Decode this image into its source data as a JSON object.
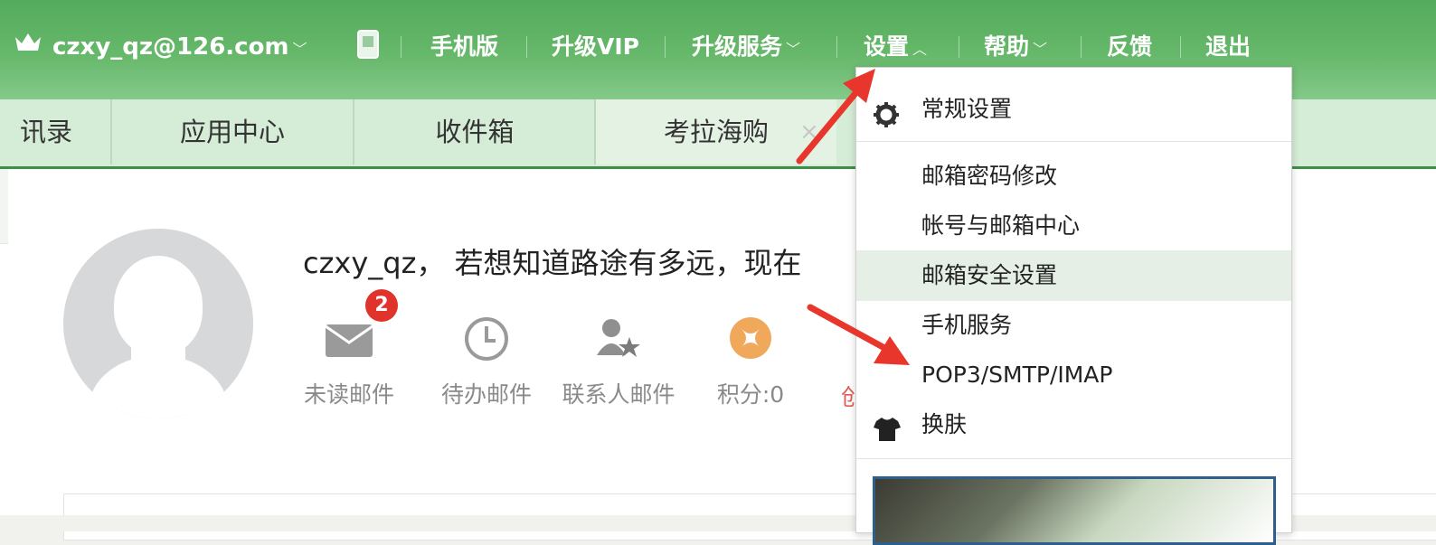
{
  "header": {
    "account": "czxy_qz@126.com",
    "nav": [
      {
        "label": "手机版"
      },
      {
        "label": "升级VIP"
      },
      {
        "label": "升级服务"
      },
      {
        "label": "设置"
      },
      {
        "label": "帮助"
      },
      {
        "label": "反馈"
      },
      {
        "label": "退出"
      }
    ]
  },
  "tabs": [
    {
      "label": "讯录"
    },
    {
      "label": "应用中心"
    },
    {
      "label": "收件箱"
    },
    {
      "label": "考拉海购"
    }
  ],
  "tab_close": "×",
  "welcome": {
    "greeting": "czxy_qz， 若想知道路途有多远，现在",
    "stats": [
      {
        "label": "未读邮件",
        "badge": "2"
      },
      {
        "label": "待办邮件"
      },
      {
        "label": "联系人邮件"
      },
      {
        "label": "积分:0"
      }
    ],
    "truncated_text": "创"
  },
  "settings_menu": {
    "items": [
      {
        "label": "常规设置"
      },
      {
        "label": "邮箱密码修改"
      },
      {
        "label": "帐号与邮箱中心"
      },
      {
        "label": "邮箱安全设置"
      },
      {
        "label": "手机服务"
      },
      {
        "label": "POP3/SMTP/IMAP"
      },
      {
        "label": "换肤"
      }
    ]
  },
  "colors": {
    "topbar": "#5fb464",
    "accent_dark": "#3d8f46",
    "badge": "#e0332b",
    "arrow": "#e8362c",
    "highlight": "#e5efe5"
  }
}
